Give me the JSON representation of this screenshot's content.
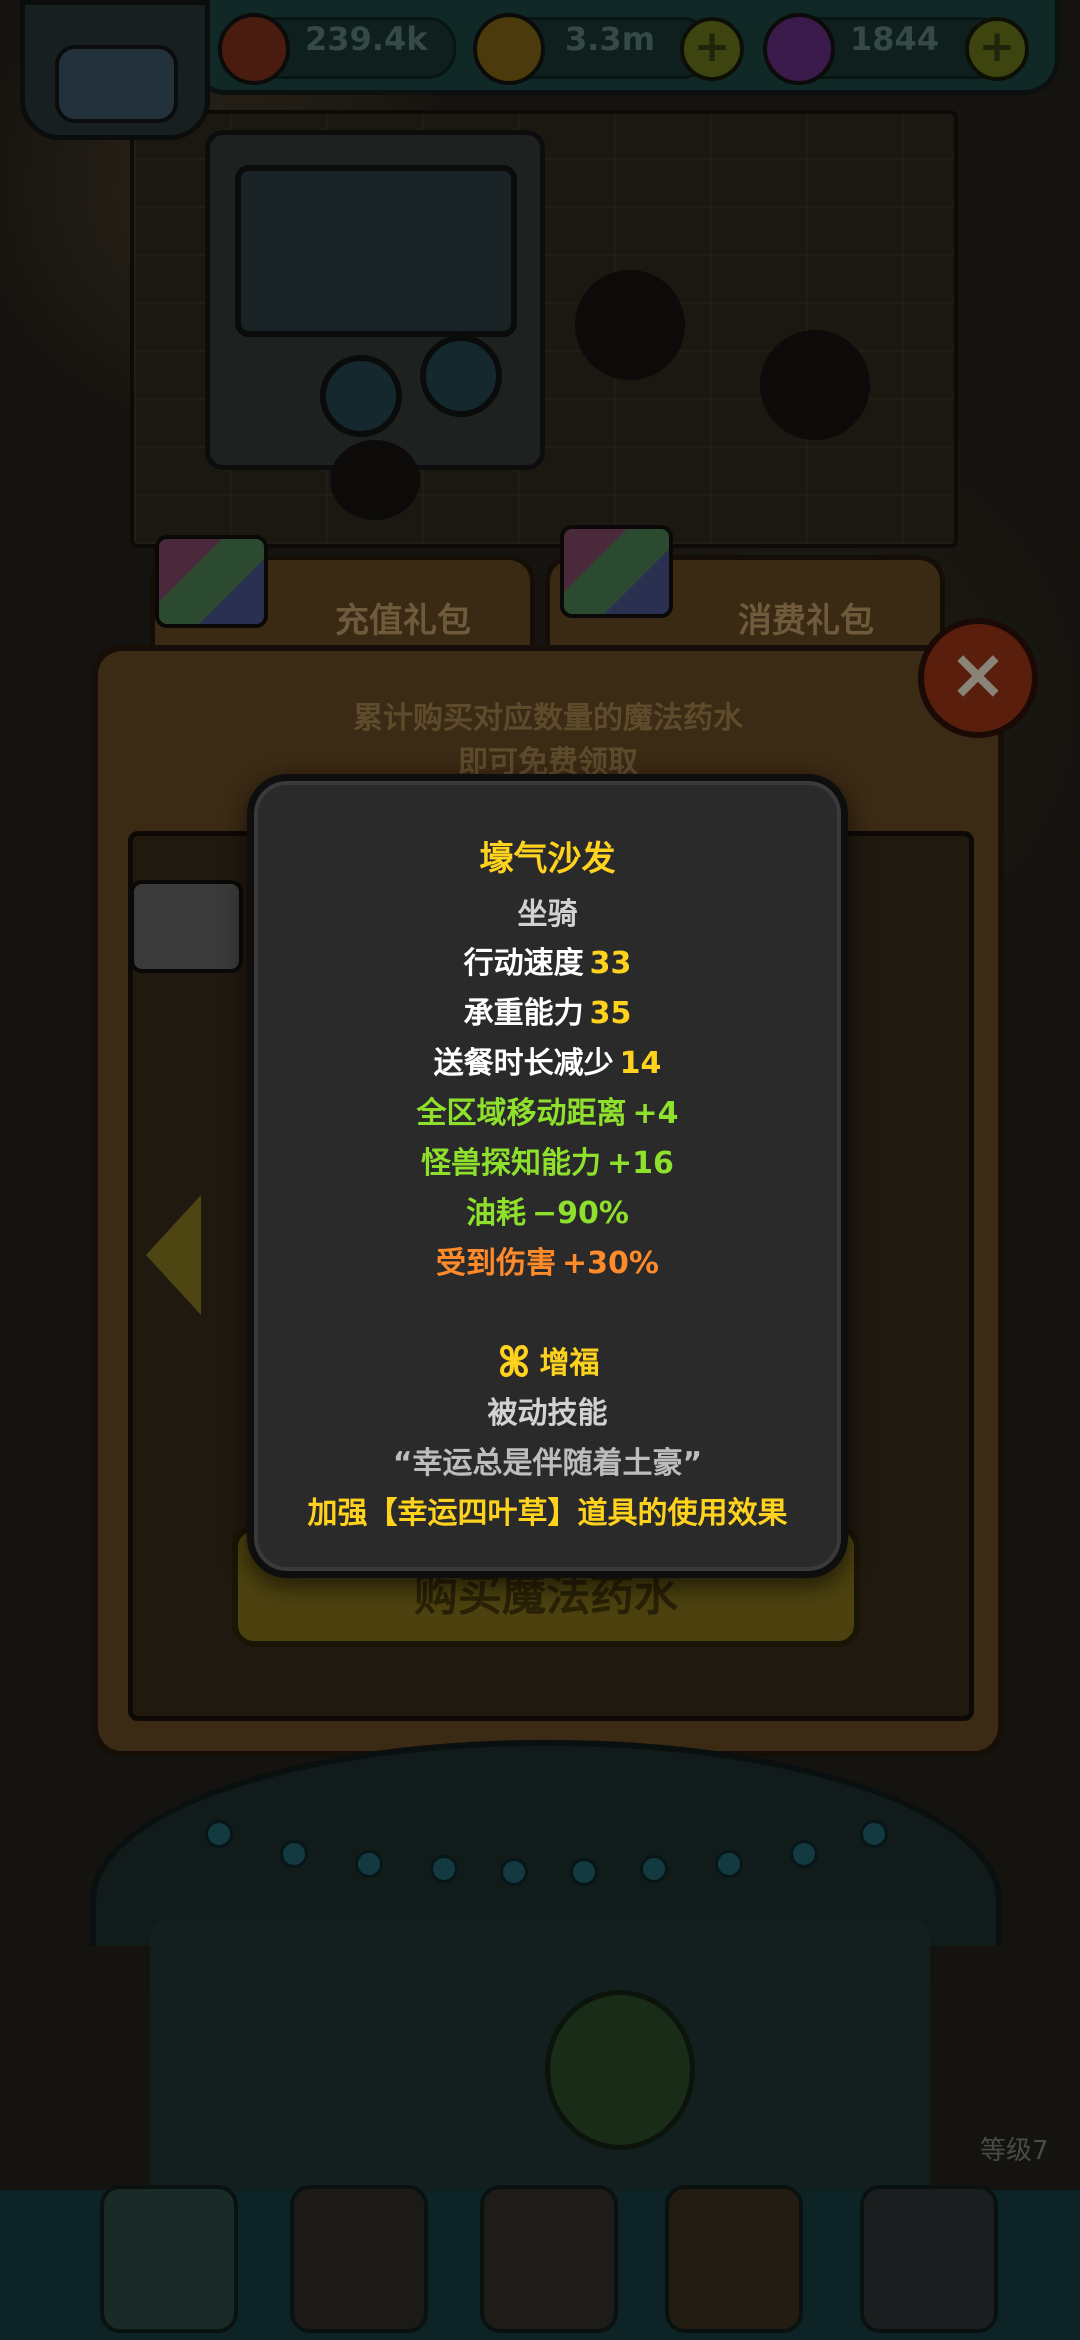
{
  "resources": [
    {
      "icon": "eyeball-icon",
      "value": "239.4k"
    },
    {
      "icon": "coin-icon",
      "value": "3.3m"
    },
    {
      "icon": "potion-icon",
      "value": "1844"
    }
  ],
  "tabs": [
    {
      "label": "充值礼包"
    },
    {
      "label": "消费礼包"
    }
  ],
  "panel": {
    "description_line1": "累计购买对应数量的魔法药水",
    "description_line2": "即可免费领取",
    "buy_button_label": "购买魔法药水",
    "close_symbol": "×"
  },
  "level_label": "等级7",
  "tooltip": {
    "item_name": "壕气沙发",
    "item_type": "坐骑",
    "stats": [
      {
        "label": "行动速度",
        "value": "33"
      },
      {
        "label": "承重能力",
        "value": "35"
      },
      {
        "label": "送餐时长减少",
        "value": "14"
      }
    ],
    "bonuses": [
      {
        "label": "全区域移动距离",
        "value": "+4"
      },
      {
        "label": "怪兽探知能力",
        "value": "+16"
      },
      {
        "label": "油耗",
        "value": "−90%"
      }
    ],
    "penalty": {
      "label": "受到伤害",
      "value": "+30%"
    },
    "skill": {
      "name": "增福",
      "type": "被动技能",
      "quote": "“幸运总是伴随着土豪”",
      "effect": "加强【幸运四叶草】道具的使用效果"
    }
  },
  "colors": {
    "yellow": "#ffd21e",
    "green": "#8ee02c",
    "orange": "#ff8a2a",
    "white": "#ffffff"
  }
}
